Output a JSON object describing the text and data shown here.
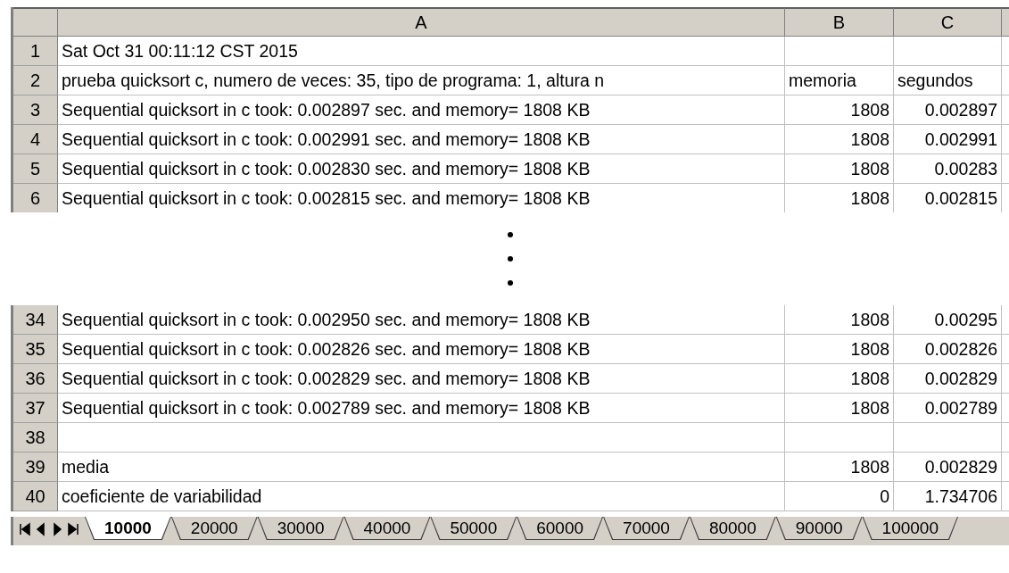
{
  "columns": [
    "A",
    "B",
    "C"
  ],
  "blocks": [
    {
      "rows": [
        {
          "number": "1",
          "kind": "text",
          "cells": [
            "Sat Oct 31 00:11:12 CST 2015",
            "",
            ""
          ]
        },
        {
          "number": "2",
          "kind": "text",
          "cells": [
            "prueba quicksort c, numero de veces: 35, tipo de programa: 1, altura n",
            "memoria",
            "segundos"
          ]
        },
        {
          "number": "3",
          "kind": "values",
          "cells": [
            "Sequential quicksort in c took: 0.002897 sec. and memory= 1808 KB",
            "1808",
            "0.002897"
          ]
        },
        {
          "number": "4",
          "kind": "values",
          "cells": [
            "Sequential quicksort in c took: 0.002991 sec. and memory= 1808 KB",
            "1808",
            "0.002991"
          ]
        },
        {
          "number": "5",
          "kind": "values",
          "cells": [
            "Sequential quicksort in c took: 0.002830 sec. and memory= 1808 KB",
            "1808",
            "0.00283"
          ]
        },
        {
          "number": "6",
          "kind": "values",
          "cells": [
            "Sequential quicksort in c took: 0.002815 sec. and memory= 1808 KB",
            "1808",
            "0.002815"
          ]
        }
      ]
    },
    {
      "rows": [
        {
          "number": "34",
          "kind": "values",
          "cells": [
            "Sequential quicksort in c took: 0.002950 sec. and memory= 1808 KB",
            "1808",
            "0.00295"
          ]
        },
        {
          "number": "35",
          "kind": "values",
          "cells": [
            "Sequential quicksort in c took: 0.002826 sec. and memory= 1808 KB",
            "1808",
            "0.002826"
          ]
        },
        {
          "number": "36",
          "kind": "values",
          "cells": [
            "Sequential quicksort in c took: 0.002829 sec. and memory= 1808 KB",
            "1808",
            "0.002829"
          ]
        },
        {
          "number": "37",
          "kind": "values",
          "cells": [
            "Sequential quicksort in c took: 0.002789 sec. and memory= 1808 KB",
            "1808",
            "0.002789"
          ]
        },
        {
          "number": "38",
          "kind": "values",
          "cells": [
            "",
            "",
            ""
          ]
        },
        {
          "number": "39",
          "kind": "values",
          "cells": [
            "media",
            "1808",
            "0.002829"
          ]
        },
        {
          "number": "40",
          "kind": "values",
          "cells": [
            "coeficiente de variabilidad",
            "0",
            "1.734706"
          ]
        }
      ]
    }
  ],
  "sheet_tabs": [
    {
      "label": "10000",
      "selected": true
    },
    {
      "label": "20000",
      "selected": false
    },
    {
      "label": "30000",
      "selected": false
    },
    {
      "label": "40000",
      "selected": false
    },
    {
      "label": "50000",
      "selected": false
    },
    {
      "label": "60000",
      "selected": false
    },
    {
      "label": "70000",
      "selected": false
    },
    {
      "label": "80000",
      "selected": false
    },
    {
      "label": "90000",
      "selected": false
    },
    {
      "label": "100000",
      "selected": false
    }
  ]
}
